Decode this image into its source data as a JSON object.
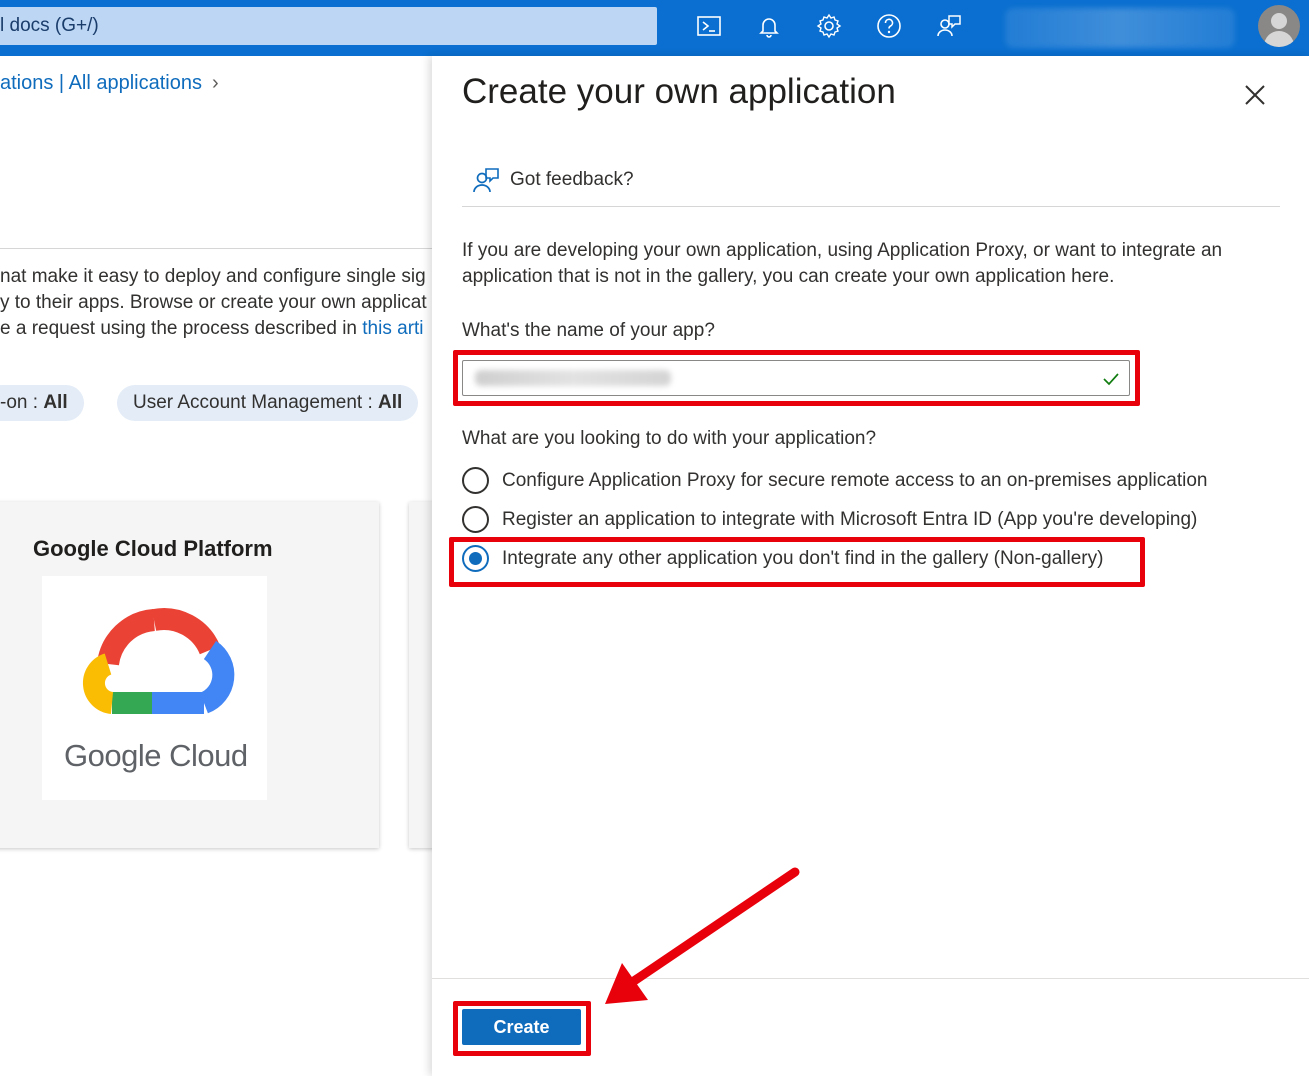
{
  "topbar": {
    "search_text": "l docs (G+/)",
    "icons": [
      "cloud-shell-icon",
      "notifications-bell-icon",
      "settings-gear-icon",
      "help-question-icon",
      "feedback-person-icon"
    ]
  },
  "background_page": {
    "breadcrumb": "ations | All applications",
    "description_lines": [
      "nat make it easy to deploy and configure single sig",
      "y to their apps. Browse or create your own applicat",
      "e a request using the process described in "
    ],
    "description_link": "this arti",
    "filters": [
      {
        "label": "-on : ",
        "value": "All"
      },
      {
        "label": "User Account Management : ",
        "value": "All"
      }
    ],
    "card": {
      "title": "Google Cloud Platform",
      "logo_text": "Google Cloud"
    }
  },
  "panel": {
    "title": "Create your own application",
    "feedback_label": "Got feedback?",
    "intro": "If you are developing your own application, using Application Proxy, or want to integrate an application that is not in the gallery, you can create your own application here.",
    "name_question": "What's the name of your app?",
    "purpose_question": "What are you looking to do with your application?",
    "options": [
      {
        "label": "Configure Application Proxy for secure remote access to an on-premises application",
        "selected": false
      },
      {
        "label": "Register an application to integrate with Microsoft Entra ID (App you're developing)",
        "selected": false
      },
      {
        "label": "Integrate any other application you don't find in the gallery (Non-gallery)",
        "selected": true
      }
    ],
    "create_label": "Create"
  },
  "colors": {
    "topbar": "#0a6fd0",
    "accent": "#0f6cbd",
    "highlight": "#e8000b",
    "valid_check": "#107c10"
  }
}
